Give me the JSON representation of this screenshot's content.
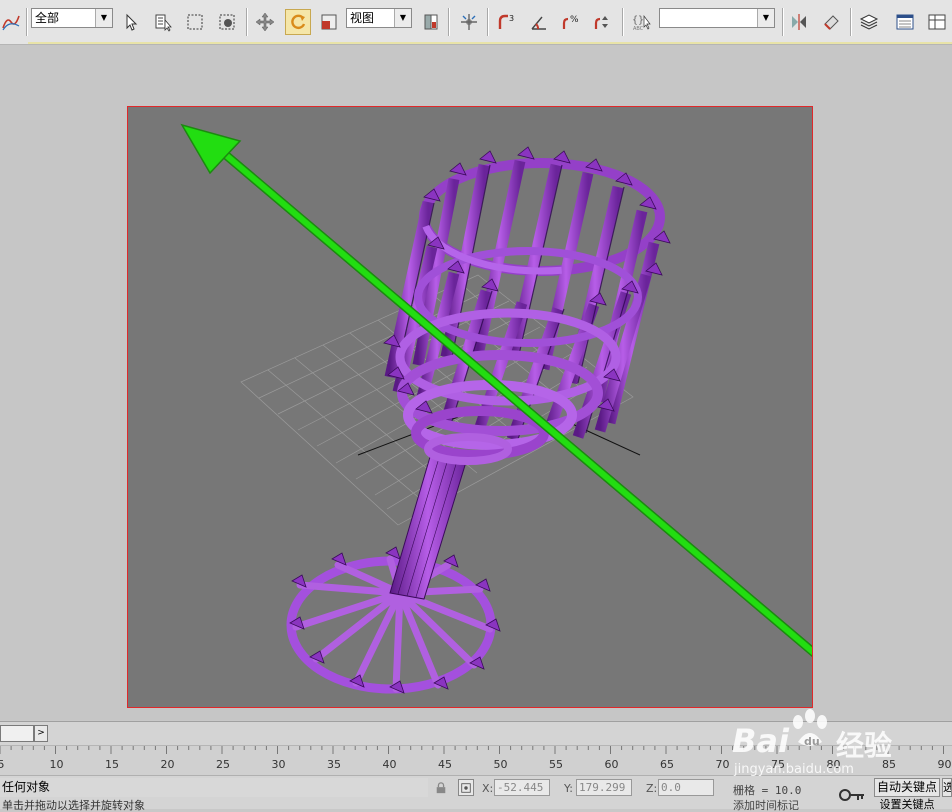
{
  "toolbar": {
    "selection_filter": "全部",
    "reference_coord": "视图",
    "named_selection": ""
  },
  "timeline": {
    "next_label": ">",
    "ticks": [
      "5",
      "10",
      "15",
      "20",
      "25",
      "30",
      "35",
      "40",
      "45",
      "50",
      "55",
      "60",
      "65",
      "70",
      "75",
      "80",
      "85",
      "90"
    ]
  },
  "status": {
    "selection_status": "任何对象",
    "prompt": "单击并拖动以选择并旋转对象",
    "x_label": "X:",
    "x_value": "-52.445",
    "y_label": "Y:",
    "y_value": "179.299",
    "z_label": "Z:",
    "z_value": "0.0",
    "grid": "栅格 = 10.0",
    "add_time_tag": "添加时间标记",
    "auto_key": "自动关键点",
    "set_key": "设置关键点",
    "edge_char": "选"
  },
  "watermark": {
    "brand": "Bai",
    "brand2": "经验",
    "url": "jingyan.baidu.com"
  },
  "colors": {
    "viewport_border": "#e0282a",
    "arrow": "#22dd11",
    "goblet": "#9a3cd0",
    "render_bg": "#777777",
    "active_tool_highlight": "#f5e6a8"
  },
  "icons": [
    "track-icon",
    "select-icon",
    "select-by-name-icon",
    "rect-region-icon",
    "window-crossing-icon",
    "move-icon",
    "rotate-icon",
    "scale-icon",
    "pivot-icon",
    "manipulate-icon",
    "snap-3d-icon",
    "angle-snap-icon",
    "percent-snap-icon",
    "spinner-snap-icon",
    "edit-named-selection-icon",
    "mirror-icon",
    "align-icon",
    "layer-manager-icon",
    "curve-editor-icon",
    "lock-icon",
    "absolute-mode-icon",
    "key-icon"
  ]
}
